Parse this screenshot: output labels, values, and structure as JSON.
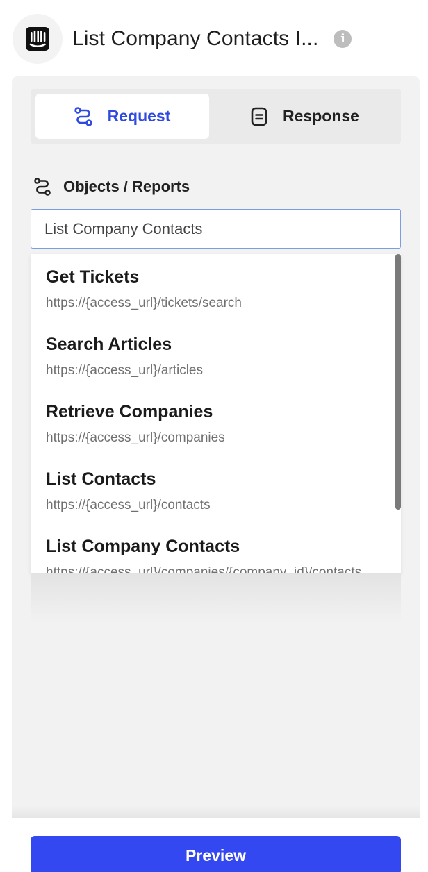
{
  "header": {
    "title": "List Company Contacts I...",
    "info_icon": "i"
  },
  "tabs": [
    {
      "label": "Request",
      "icon": "route-icon",
      "active": true
    },
    {
      "label": "Response",
      "icon": "document-icon",
      "active": false
    }
  ],
  "section": {
    "label": "Objects / Reports",
    "icon": "route-icon"
  },
  "search": {
    "value": "List Company Contacts"
  },
  "options": [
    {
      "title": "Get Tickets",
      "url": "https://{access_url}/tickets/search"
    },
    {
      "title": "Search Articles",
      "url": "https://{access_url}/articles"
    },
    {
      "title": "Retrieve Companies",
      "url": "https://{access_url}/companies"
    },
    {
      "title": "List Contacts",
      "url": "https://{access_url}/contacts"
    },
    {
      "title": "List Company Contacts",
      "url": "https://{access_url}/companies/{company_id}/contacts"
    }
  ],
  "footer": {
    "preview_label": "Preview"
  },
  "colors": {
    "accent": "#3348f0",
    "active_tab_text": "#2f4ae0",
    "panel_bg": "#f2f2f2"
  }
}
